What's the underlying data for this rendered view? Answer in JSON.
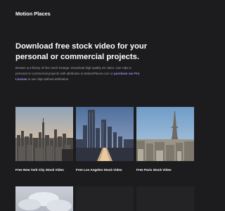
{
  "header": {
    "brand": "Motion Places"
  },
  "hero": {
    "title": "Download free stock video for your personal or commercial projects.",
    "text_part1": "Browse our library of free stock footage. Download high quality 4K video. Use clips in personal or commercial projects with attribution to MotionPlaces.com or",
    "link_text": "purchase our Pro License",
    "text_part2": "to use clips without attribution."
  },
  "gallery": {
    "items": [
      {
        "title": "Free New York City Stock Video",
        "icon": "new-york-skyline-image"
      },
      {
        "title": "Free Los Angeles Stock Video",
        "icon": "los-angeles-skyline-image"
      },
      {
        "title": "Free Paris Stock Video",
        "icon": "paris-skyline-image"
      }
    ]
  },
  "colors": {
    "background": "#1c1c1e",
    "link_accent": "#a48cf0",
    "body_text": "#a4a4a8"
  }
}
